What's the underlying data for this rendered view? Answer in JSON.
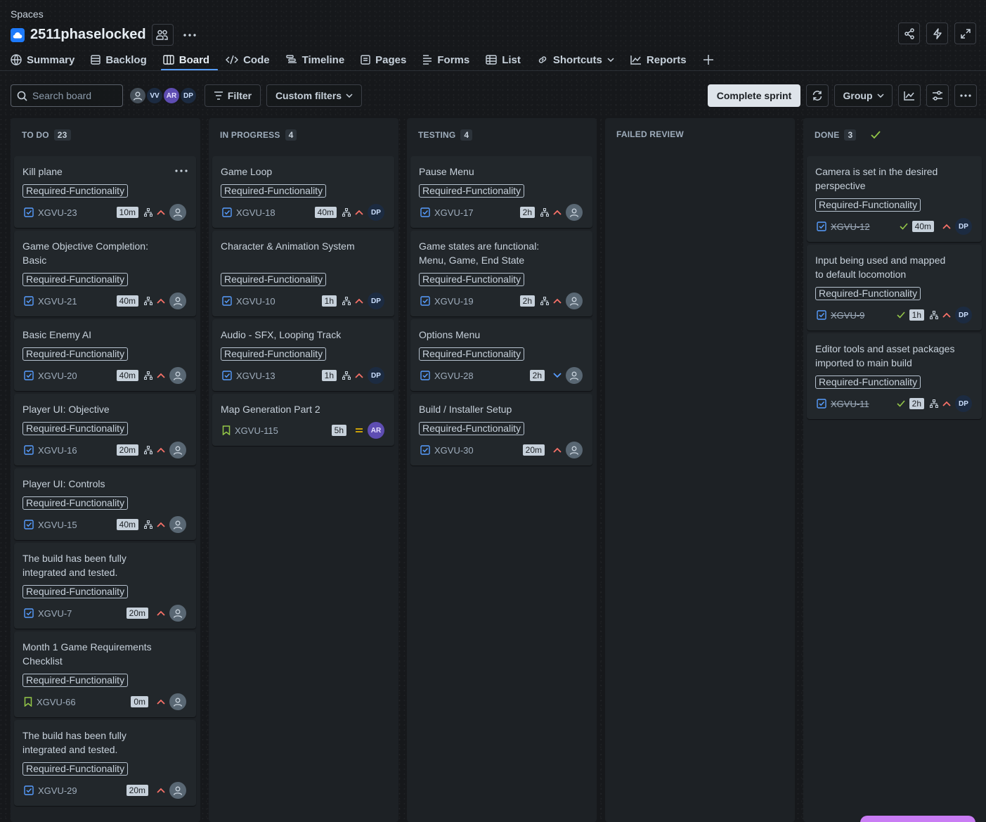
{
  "header": {
    "breadcrumb": "Spaces",
    "project_title": "2511phaselocked",
    "tabs": [
      {
        "label": "Summary",
        "icon": "globe-icon"
      },
      {
        "label": "Backlog",
        "icon": "list-icon"
      },
      {
        "label": "Board",
        "icon": "board-icon",
        "active": true
      },
      {
        "label": "Code",
        "icon": "code-icon"
      },
      {
        "label": "Timeline",
        "icon": "timeline-icon"
      },
      {
        "label": "Pages",
        "icon": "pages-icon"
      },
      {
        "label": "Forms",
        "icon": "forms-icon"
      },
      {
        "label": "List",
        "icon": "table-icon"
      },
      {
        "label": "Shortcuts",
        "icon": "link-icon"
      },
      {
        "label": "Reports",
        "icon": "chart-icon"
      }
    ]
  },
  "toolbar": {
    "search_placeholder": "Search board",
    "avatars": [
      "VV",
      "AR",
      "DP"
    ],
    "filter_label": "Filter",
    "custom_filters_label": "Custom filters",
    "complete_sprint_label": "Complete sprint",
    "group_label": "Group"
  },
  "colors": {
    "accent": "#579dff",
    "priority_high": "#f87168",
    "priority_low": "#579dff",
    "priority_medium": "#e2b203",
    "done_check": "#94c748",
    "story": "#94c748",
    "task": "#579dff"
  },
  "columns": [
    {
      "name": "TO DO",
      "count": "23",
      "cards": [
        {
          "title": "Kill plane",
          "label": "Required-Functionality",
          "key": "XGVU-23",
          "estimate": "10m",
          "subtasks": true,
          "priority": "high",
          "assignee": "",
          "type": "task"
        },
        {
          "title": "Game Objective Completion: Basic",
          "label": "Required-Functionality",
          "key": "XGVU-21",
          "estimate": "40m",
          "subtasks": true,
          "priority": "high",
          "assignee": "",
          "type": "task"
        },
        {
          "title": "Basic Enemy AI",
          "label": "Required-Functionality",
          "key": "XGVU-20",
          "estimate": "40m",
          "subtasks": true,
          "priority": "high",
          "assignee": "",
          "type": "task"
        },
        {
          "title": "Player UI: Objective",
          "label": "Required-Functionality",
          "key": "XGVU-16",
          "estimate": "20m",
          "subtasks": true,
          "priority": "high",
          "assignee": "",
          "type": "task"
        },
        {
          "title": "Player UI: Controls",
          "label": "Required-Functionality",
          "key": "XGVU-15",
          "estimate": "40m",
          "subtasks": true,
          "priority": "high",
          "assignee": "",
          "type": "task"
        },
        {
          "title": "The build has been fully integrated and tested.",
          "label": "Required-Functionality",
          "key": "XGVU-7",
          "estimate": "20m",
          "subtasks": false,
          "priority": "high",
          "assignee": "",
          "type": "task"
        },
        {
          "title": "Month 1 Game Requirements Checklist",
          "label": "Required-Functionality",
          "key": "XGVU-66",
          "estimate": "0m",
          "subtasks": false,
          "priority": "high",
          "assignee": "",
          "type": "story"
        },
        {
          "title": "The build has been fully integrated and tested.",
          "label": "Required-Functionality",
          "key": "XGVU-29",
          "estimate": "20m",
          "subtasks": false,
          "priority": "high",
          "assignee": "",
          "type": "task"
        }
      ]
    },
    {
      "name": "IN PROGRESS",
      "count": "4",
      "cards": [
        {
          "title": "Game Loop",
          "label": "Required-Functionality",
          "key": "XGVU-18",
          "estimate": "40m",
          "subtasks": true,
          "priority": "high",
          "assignee": "DP",
          "type": "task"
        },
        {
          "title": "Character & Animation System",
          "label": "Required-Functionality",
          "key": "XGVU-10",
          "estimate": "1h",
          "subtasks": true,
          "priority": "high",
          "assignee": "DP",
          "type": "task"
        },
        {
          "title": "Audio - SFX, Looping Track",
          "label": "Required-Functionality",
          "key": "XGVU-13",
          "estimate": "1h",
          "subtasks": true,
          "priority": "high",
          "assignee": "DP",
          "type": "task"
        },
        {
          "title": "Map Generation Part 2",
          "label": "",
          "key": "XGVU-115",
          "estimate": "5h",
          "subtasks": false,
          "priority": "medium",
          "assignee": "AR",
          "type": "story"
        }
      ]
    },
    {
      "name": "TESTING",
      "count": "4",
      "cards": [
        {
          "title": "Pause Menu",
          "label": "Required-Functionality",
          "key": "XGVU-17",
          "estimate": "2h",
          "subtasks": true,
          "priority": "high",
          "assignee": "",
          "type": "task"
        },
        {
          "title": "Game states are functional: Menu, Game, End State",
          "label": "Required-Functionality",
          "key": "XGVU-19",
          "estimate": "2h",
          "subtasks": true,
          "priority": "high",
          "assignee": "",
          "type": "task"
        },
        {
          "title": "Options Menu",
          "label": "Required-Functionality",
          "key": "XGVU-28",
          "estimate": "2h",
          "subtasks": false,
          "priority": "low",
          "assignee": "",
          "type": "task"
        },
        {
          "title": "Build / Installer Setup",
          "label": "Required-Functionality",
          "key": "XGVU-30",
          "estimate": "20m",
          "subtasks": false,
          "priority": "high",
          "assignee": "",
          "type": "task"
        }
      ]
    },
    {
      "name": "FAILED REVIEW",
      "count": "",
      "cards": []
    },
    {
      "name": "DONE",
      "count": "3",
      "cards": [
        {
          "title": "Camera is set in the desired perspective",
          "label": "Required-Functionality",
          "key": "XGVU-12",
          "estimate": "40m",
          "subtasks": false,
          "priority": "high",
          "assignee": "DP",
          "type": "task",
          "done": true
        },
        {
          "title": "Input being used and mapped to default locomotion",
          "label": "Required-Functionality",
          "key": "XGVU-9",
          "estimate": "1h",
          "subtasks": true,
          "priority": "high",
          "assignee": "DP",
          "type": "task",
          "done": true
        },
        {
          "title": "Editor tools and asset packages imported to main build",
          "label": "Required-Functionality",
          "key": "XGVU-11",
          "estimate": "2h",
          "subtasks": true,
          "priority": "high",
          "assignee": "DP",
          "type": "task",
          "done": true
        }
      ]
    }
  ]
}
